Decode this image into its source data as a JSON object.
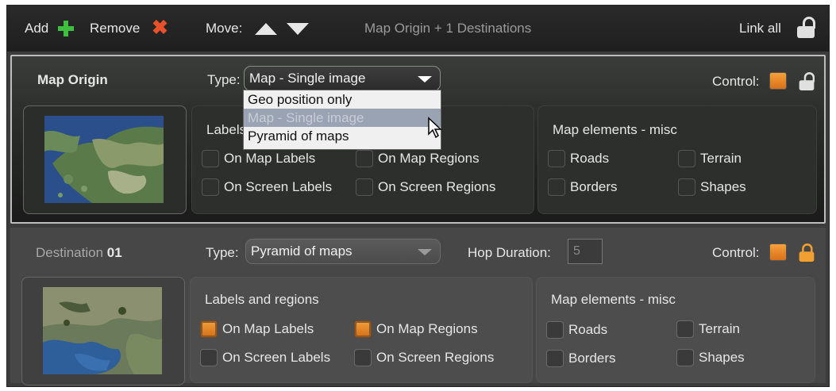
{
  "toolbar": {
    "add_label": "Add",
    "remove_label": "Remove",
    "move_label": "Move:",
    "title": "Map Origin + 1 Destinations",
    "link_all_label": "Link all"
  },
  "origin": {
    "title": "Map Origin",
    "type_label": "Type:",
    "type_value": "Map - Single image",
    "control_label": "Control:",
    "labels_group": {
      "title": "Labels",
      "items": [
        {
          "label": "On Map Labels",
          "checked": false
        },
        {
          "label": "On Map Regions",
          "checked": false
        },
        {
          "label": "On Screen Labels",
          "checked": false
        },
        {
          "label": "On Screen Regions",
          "checked": false
        }
      ]
    },
    "misc_group": {
      "title": "Map elements - misc",
      "items": [
        {
          "label": "Roads",
          "checked": false
        },
        {
          "label": "Terrain",
          "checked": false
        },
        {
          "label": "Borders",
          "checked": false
        },
        {
          "label": "Shapes",
          "checked": false
        }
      ]
    },
    "dropdown_options": [
      "Geo position only",
      "Map - Single image",
      "Pyramid of maps"
    ],
    "dropdown_highlighted": "Map - Single image"
  },
  "destination": {
    "title_prefix": "Destination",
    "title_number": "01",
    "type_label": "Type:",
    "type_value": "Pyramid of maps",
    "hop_label": "Hop Duration:",
    "hop_value": "5",
    "control_label": "Control:",
    "labels_group": {
      "title": "Labels and regions",
      "items": [
        {
          "label": "On Map Labels",
          "checked": true
        },
        {
          "label": "On Map Regions",
          "checked": true
        },
        {
          "label": "On Screen Labels",
          "checked": false
        },
        {
          "label": "On Screen Regions",
          "checked": false
        }
      ]
    },
    "misc_group": {
      "title": "Map elements - misc",
      "items": [
        {
          "label": "Roads",
          "checked": false
        },
        {
          "label": "Terrain",
          "checked": false
        },
        {
          "label": "Borders",
          "checked": false
        },
        {
          "label": "Shapes",
          "checked": false
        }
      ]
    }
  },
  "colors": {
    "accent_orange": "#e8851f",
    "add_green": "#3fbf3f",
    "remove_red": "#e8512a"
  },
  "icons": [
    "plus-icon",
    "x-icon",
    "arrow-up-icon",
    "arrow-down-icon",
    "lock-icon",
    "mouse-cursor-icon"
  ]
}
